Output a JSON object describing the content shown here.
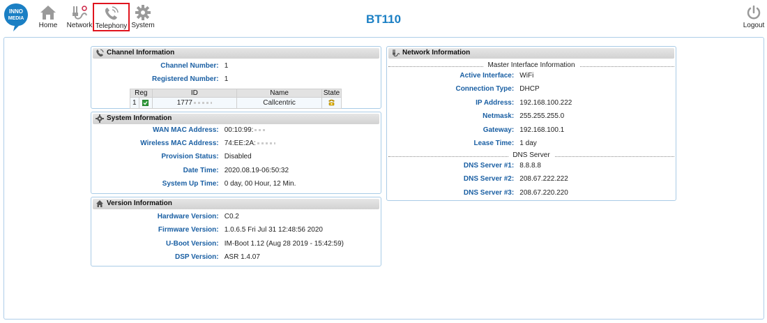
{
  "header": {
    "logo_text_line1": "INNO",
    "logo_text_line2": "MEDIA",
    "title": "BT110",
    "nav": [
      {
        "label": "Home",
        "icon": "home-icon"
      },
      {
        "label": "Network",
        "icon": "network-icon"
      },
      {
        "label": "Telephony",
        "icon": "phone-icon",
        "selected": true
      },
      {
        "label": "System",
        "icon": "gear-icon"
      }
    ],
    "logout_label": "Logout"
  },
  "channel": {
    "title": "Channel Information",
    "rows": [
      {
        "label": "Channel Number:",
        "value": "1"
      },
      {
        "label": "Registered Number:",
        "value": "1"
      }
    ],
    "table": {
      "headers": [
        "Reg",
        "ID",
        "Name",
        "State"
      ],
      "rows": [
        {
          "index": "1",
          "id": "1777",
          "name": "Callcentric"
        }
      ]
    }
  },
  "system": {
    "title": "System Information",
    "rows": [
      {
        "label": "WAN MAC Address:",
        "value": "00:10:99:"
      },
      {
        "label": "Wireless MAC Address:",
        "value": "74:EE:2A:"
      },
      {
        "label": "Provision Status:",
        "value": "Disabled"
      },
      {
        "label": "Date Time:",
        "value": "2020.08.19-06:50:32"
      },
      {
        "label": "System Up Time:",
        "value": "0 day, 00 Hour, 12 Min."
      }
    ]
  },
  "version": {
    "title": "Version Information",
    "rows": [
      {
        "label": "Hardware Version:",
        "value": "C0.2"
      },
      {
        "label": "Firmware Version:",
        "value": "1.0.6.5 Fri Jul 31 12:48:56 2020"
      },
      {
        "label": "U-Boot Version:",
        "value": "IM-Boot 1.12 (Aug 28 2019 - 15:42:59)"
      },
      {
        "label": "DSP Version:",
        "value": "ASR 1.4.07"
      }
    ]
  },
  "network": {
    "title": "Network Information",
    "master_header": "Master Interface Information",
    "rows": [
      {
        "label": "Active Interface:",
        "value": "WiFi"
      },
      {
        "label": "Connection Type:",
        "value": "DHCP"
      },
      {
        "label": "IP Address:",
        "value": "192.168.100.222"
      },
      {
        "label": "Netmask:",
        "value": "255.255.255.0"
      },
      {
        "label": "Gateway:",
        "value": "192.168.100.1"
      },
      {
        "label": "Lease Time:",
        "value": "1 day"
      }
    ],
    "dns_header": "DNS Server",
    "dns_rows": [
      {
        "label": "DNS Server #1:",
        "value": "8.8.8.8"
      },
      {
        "label": "DNS Server #2:",
        "value": "208.67.222.222"
      },
      {
        "label": "DNS Server #3:",
        "value": "208.67.220.220"
      }
    ]
  },
  "colors": {
    "accent": "#1a7fc4",
    "label": "#1a5fa3",
    "selected_border": "#e0141e"
  }
}
